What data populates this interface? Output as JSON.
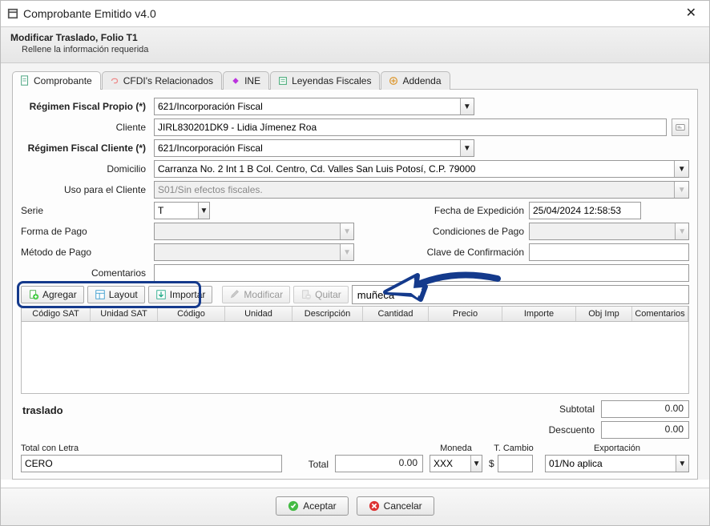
{
  "window": {
    "title": "Comprobante Emitido v4.0",
    "subtitle": "Modificar Traslado, Folio T1",
    "instruction": "Rellene la información requerida"
  },
  "tabs": {
    "comprobante": "Comprobante",
    "cfdis": "CFDI's Relacionados",
    "ine": "INE",
    "leyendas": "Leyendas Fiscales",
    "addenda": "Addenda"
  },
  "labels": {
    "regimen_propio": "Régimen Fiscal Propio (*)",
    "cliente": "Cliente",
    "regimen_cliente": "Régimen Fiscal Cliente (*)",
    "domicilio": "Domicilio",
    "uso_cliente": "Uso para el Cliente",
    "serie": "Serie",
    "fecha_exp": "Fecha de Expedición",
    "forma_pago": "Forma de Pago",
    "cond_pago": "Condiciones de Pago",
    "metodo_pago": "Método de Pago",
    "clave_conf": "Clave de Confirmación",
    "comentarios": "Comentarios",
    "traslado": "traslado",
    "subtotal": "Subtotal",
    "descuento": "Descuento",
    "total_letra": "Total con Letra",
    "total": "Total",
    "moneda": "Moneda",
    "tcambio": "T. Cambio",
    "exportacion": "Exportación"
  },
  "values": {
    "regimen_propio": "621/Incorporación Fiscal",
    "cliente": "JIRL830201DK9 - Lidia Jímenez Roa",
    "regimen_cliente": "621/Incorporación Fiscal",
    "domicilio": "Carranza No. 2 Int 1 B Col. Centro, Cd. Valles San Luis Potosí, C.P. 79000",
    "uso_cliente": "S01/Sin efectos fiscales.",
    "serie": "T",
    "fecha_exp": "25/04/2024 12:58:53",
    "forma_pago": "",
    "cond_pago": "",
    "metodo_pago": "",
    "clave_conf": "",
    "comentarios": "",
    "search": "muñeca",
    "subtotal": "0.00",
    "descuento": "0.00",
    "total_letra": "CERO",
    "total": "0.00",
    "moneda": "XXX",
    "tcambio": "",
    "tcambio_prefix": "$",
    "exportacion": "01/No aplica"
  },
  "toolbar": {
    "agregar": "Agregar",
    "layout": "Layout",
    "importar": "Importar",
    "modificar": "Modificar",
    "quitar": "Quitar"
  },
  "grid": {
    "headers": [
      "Código SAT",
      "Unidad SAT",
      "Código",
      "Unidad",
      "Descripción",
      "Cantidad",
      "Precio",
      "Importe",
      "Obj Imp",
      "Comentarios"
    ]
  },
  "footer": {
    "aceptar": "Aceptar",
    "cancelar": "Cancelar"
  }
}
